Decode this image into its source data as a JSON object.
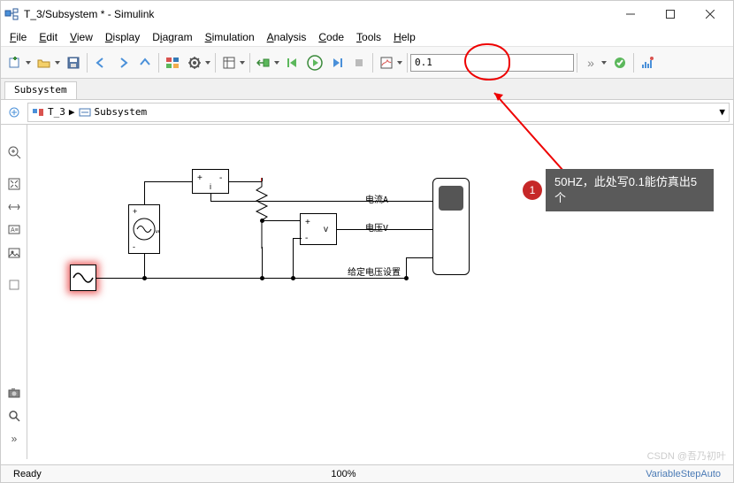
{
  "window": {
    "title": "T_3/Subsystem * - Simulink"
  },
  "menus": {
    "file": "File",
    "edit": "Edit",
    "view": "View",
    "display": "Display",
    "diagram": "Diagram",
    "simulation": "Simulation",
    "analysis": "Analysis",
    "code": "Code",
    "tools": "Tools",
    "help": "Help"
  },
  "toolbar": {
    "stop_time": "0.1"
  },
  "tabs": {
    "active": "Subsystem"
  },
  "breadcrumb": {
    "root": "T_3",
    "leaf": "Subsystem"
  },
  "canvas": {
    "labels": {
      "currentA": "电流A",
      "voltageV": "电压V",
      "setVoltage": "给定电压设置"
    }
  },
  "annotation": {
    "number": "1",
    "text": "50HZ，此处写0.1能仿真出5个"
  },
  "status": {
    "ready": "Ready",
    "zoom": "100%",
    "solver": "VariableStepAuto"
  },
  "watermark": "CSDN @吾乃初叶"
}
